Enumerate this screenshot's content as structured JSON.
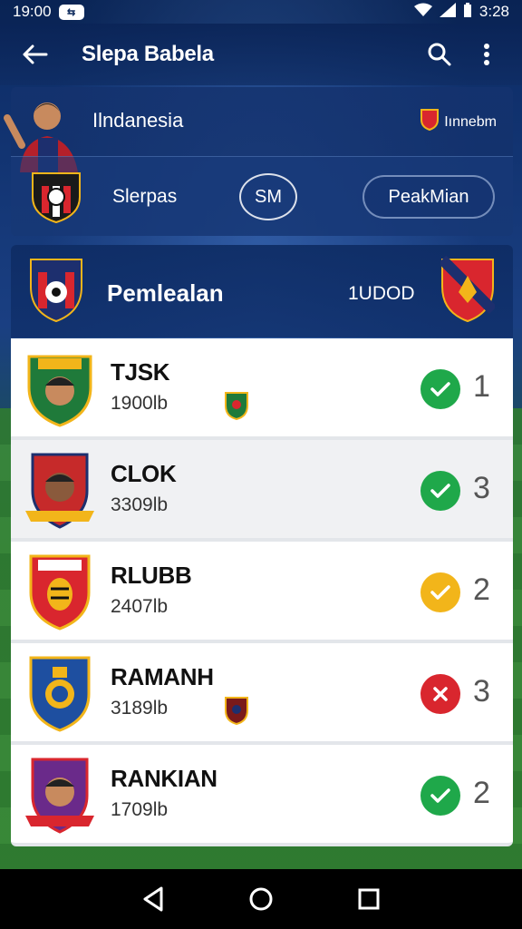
{
  "status_bar": {
    "time": "19:00",
    "right_time": "3:28"
  },
  "app_bar": {
    "title": "Slepa Babela",
    "icons": [
      "back-arrow-icon",
      "search-icon",
      "more-vert-icon"
    ]
  },
  "hero": {
    "country": "Ilndanesia",
    "brand": "Iınnebm",
    "subtitle": "Slerpas",
    "circle_button": "SM",
    "pill_button": "PeakMian"
  },
  "league": {
    "name": "Pemlealan",
    "score": "1UDOD"
  },
  "rows": [
    {
      "name": "TJSK",
      "sub": "1900lb",
      "status": "check",
      "count": "1",
      "has_mini": true
    },
    {
      "name": "CLOK",
      "sub": "3309lb",
      "status": "check",
      "count": "3",
      "has_mini": false
    },
    {
      "name": "RLUBB",
      "sub": "2407lb",
      "status": "warn",
      "count": "2",
      "has_mini": false
    },
    {
      "name": "RAMANH",
      "sub": "3189lb",
      "status": "error",
      "count": "3",
      "has_mini": true
    },
    {
      "name": "RANKIAN",
      "sub": "1709lb",
      "status": "check",
      "count": "2",
      "has_mini": false
    }
  ],
  "colors": {
    "check": "#1fa84a",
    "warn": "#f2b51a",
    "error": "#d9262e",
    "accent": "#0d2a5c"
  },
  "nav": [
    "back-icon",
    "home-icon",
    "recents-icon"
  ]
}
